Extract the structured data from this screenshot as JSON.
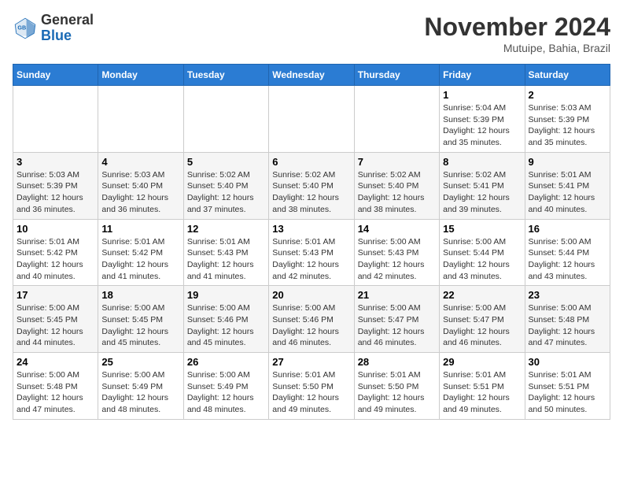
{
  "header": {
    "logo_general": "General",
    "logo_blue": "Blue",
    "month_title": "November 2024",
    "location": "Mutuipe, Bahia, Brazil"
  },
  "days_of_week": [
    "Sunday",
    "Monday",
    "Tuesday",
    "Wednesday",
    "Thursday",
    "Friday",
    "Saturday"
  ],
  "weeks": [
    [
      {
        "day": "",
        "info": ""
      },
      {
        "day": "",
        "info": ""
      },
      {
        "day": "",
        "info": ""
      },
      {
        "day": "",
        "info": ""
      },
      {
        "day": "",
        "info": ""
      },
      {
        "day": "1",
        "info": "Sunrise: 5:04 AM\nSunset: 5:39 PM\nDaylight: 12 hours and 35 minutes."
      },
      {
        "day": "2",
        "info": "Sunrise: 5:03 AM\nSunset: 5:39 PM\nDaylight: 12 hours and 35 minutes."
      }
    ],
    [
      {
        "day": "3",
        "info": "Sunrise: 5:03 AM\nSunset: 5:39 PM\nDaylight: 12 hours and 36 minutes."
      },
      {
        "day": "4",
        "info": "Sunrise: 5:03 AM\nSunset: 5:40 PM\nDaylight: 12 hours and 36 minutes."
      },
      {
        "day": "5",
        "info": "Sunrise: 5:02 AM\nSunset: 5:40 PM\nDaylight: 12 hours and 37 minutes."
      },
      {
        "day": "6",
        "info": "Sunrise: 5:02 AM\nSunset: 5:40 PM\nDaylight: 12 hours and 38 minutes."
      },
      {
        "day": "7",
        "info": "Sunrise: 5:02 AM\nSunset: 5:40 PM\nDaylight: 12 hours and 38 minutes."
      },
      {
        "day": "8",
        "info": "Sunrise: 5:02 AM\nSunset: 5:41 PM\nDaylight: 12 hours and 39 minutes."
      },
      {
        "day": "9",
        "info": "Sunrise: 5:01 AM\nSunset: 5:41 PM\nDaylight: 12 hours and 40 minutes."
      }
    ],
    [
      {
        "day": "10",
        "info": "Sunrise: 5:01 AM\nSunset: 5:42 PM\nDaylight: 12 hours and 40 minutes."
      },
      {
        "day": "11",
        "info": "Sunrise: 5:01 AM\nSunset: 5:42 PM\nDaylight: 12 hours and 41 minutes."
      },
      {
        "day": "12",
        "info": "Sunrise: 5:01 AM\nSunset: 5:43 PM\nDaylight: 12 hours and 41 minutes."
      },
      {
        "day": "13",
        "info": "Sunrise: 5:01 AM\nSunset: 5:43 PM\nDaylight: 12 hours and 42 minutes."
      },
      {
        "day": "14",
        "info": "Sunrise: 5:00 AM\nSunset: 5:43 PM\nDaylight: 12 hours and 42 minutes."
      },
      {
        "day": "15",
        "info": "Sunrise: 5:00 AM\nSunset: 5:44 PM\nDaylight: 12 hours and 43 minutes."
      },
      {
        "day": "16",
        "info": "Sunrise: 5:00 AM\nSunset: 5:44 PM\nDaylight: 12 hours and 43 minutes."
      }
    ],
    [
      {
        "day": "17",
        "info": "Sunrise: 5:00 AM\nSunset: 5:45 PM\nDaylight: 12 hours and 44 minutes."
      },
      {
        "day": "18",
        "info": "Sunrise: 5:00 AM\nSunset: 5:45 PM\nDaylight: 12 hours and 45 minutes."
      },
      {
        "day": "19",
        "info": "Sunrise: 5:00 AM\nSunset: 5:46 PM\nDaylight: 12 hours and 45 minutes."
      },
      {
        "day": "20",
        "info": "Sunrise: 5:00 AM\nSunset: 5:46 PM\nDaylight: 12 hours and 46 minutes."
      },
      {
        "day": "21",
        "info": "Sunrise: 5:00 AM\nSunset: 5:47 PM\nDaylight: 12 hours and 46 minutes."
      },
      {
        "day": "22",
        "info": "Sunrise: 5:00 AM\nSunset: 5:47 PM\nDaylight: 12 hours and 46 minutes."
      },
      {
        "day": "23",
        "info": "Sunrise: 5:00 AM\nSunset: 5:48 PM\nDaylight: 12 hours and 47 minutes."
      }
    ],
    [
      {
        "day": "24",
        "info": "Sunrise: 5:00 AM\nSunset: 5:48 PM\nDaylight: 12 hours and 47 minutes."
      },
      {
        "day": "25",
        "info": "Sunrise: 5:00 AM\nSunset: 5:49 PM\nDaylight: 12 hours and 48 minutes."
      },
      {
        "day": "26",
        "info": "Sunrise: 5:00 AM\nSunset: 5:49 PM\nDaylight: 12 hours and 48 minutes."
      },
      {
        "day": "27",
        "info": "Sunrise: 5:01 AM\nSunset: 5:50 PM\nDaylight: 12 hours and 49 minutes."
      },
      {
        "day": "28",
        "info": "Sunrise: 5:01 AM\nSunset: 5:50 PM\nDaylight: 12 hours and 49 minutes."
      },
      {
        "day": "29",
        "info": "Sunrise: 5:01 AM\nSunset: 5:51 PM\nDaylight: 12 hours and 49 minutes."
      },
      {
        "day": "30",
        "info": "Sunrise: 5:01 AM\nSunset: 5:51 PM\nDaylight: 12 hours and 50 minutes."
      }
    ]
  ]
}
